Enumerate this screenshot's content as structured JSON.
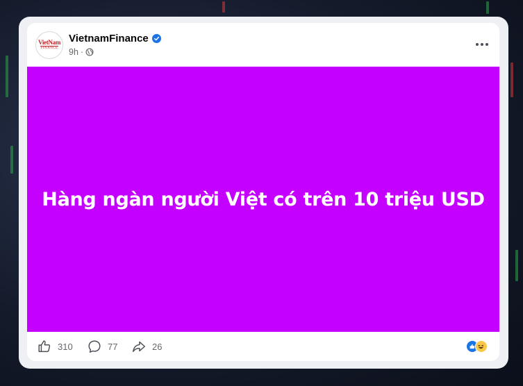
{
  "post": {
    "page_name": "VietnamFinance",
    "time": "9h",
    "separator": "·",
    "avatar": {
      "logo_top": "VietNam",
      "logo_bottom": "FINANCE"
    },
    "image": {
      "background_color": "#c400ff",
      "headline": "Hàng ngàn người Việt có trên 10 triệu USD"
    },
    "stats": {
      "likes": "310",
      "comments": "77",
      "shares": "26"
    },
    "reactions": [
      "like-icon",
      "haha-icon"
    ]
  },
  "colors": {
    "verified": "#1b74e4",
    "meta_text": "#65676b",
    "accent": "#c400ff"
  }
}
